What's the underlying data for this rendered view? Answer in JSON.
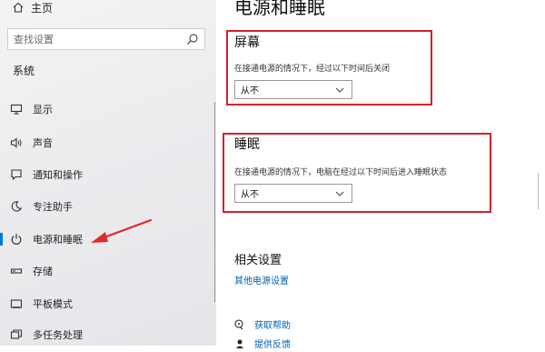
{
  "sidebar": {
    "home_label": "主页",
    "search_placeholder": "查找设置",
    "section_title": "系统",
    "items": [
      {
        "label": "显示",
        "icon": "monitor-icon"
      },
      {
        "label": "声音",
        "icon": "speaker-icon"
      },
      {
        "label": "通知和操作",
        "icon": "notification-icon"
      },
      {
        "label": "专注助手",
        "icon": "moon-icon"
      },
      {
        "label": "电源和睡眠",
        "icon": "power-icon",
        "selected": true
      },
      {
        "label": "存储",
        "icon": "storage-icon"
      },
      {
        "label": "平板模式",
        "icon": "tablet-icon"
      },
      {
        "label": "多任务处理",
        "icon": "multitask-icon"
      }
    ]
  },
  "main": {
    "title": "电源和睡眠",
    "screen": {
      "heading": "屏幕",
      "description": "在接通电源的情况下，经过以下时间后关闭",
      "value": "从不"
    },
    "sleep": {
      "heading": "睡眠",
      "description": "在接通电源的情况下，电脑在经过以下时间后进入睡眠状态",
      "value": "从不"
    },
    "related": {
      "heading": "相关设置",
      "link": "其他电源设置"
    },
    "help": {
      "get_help": "获取帮助",
      "feedback": "提供反馈"
    }
  },
  "colors": {
    "accent": "#0078d7",
    "highlight_box": "#d5212b",
    "annotation_arrow": "#e02a2a",
    "link": "#0063b1"
  }
}
